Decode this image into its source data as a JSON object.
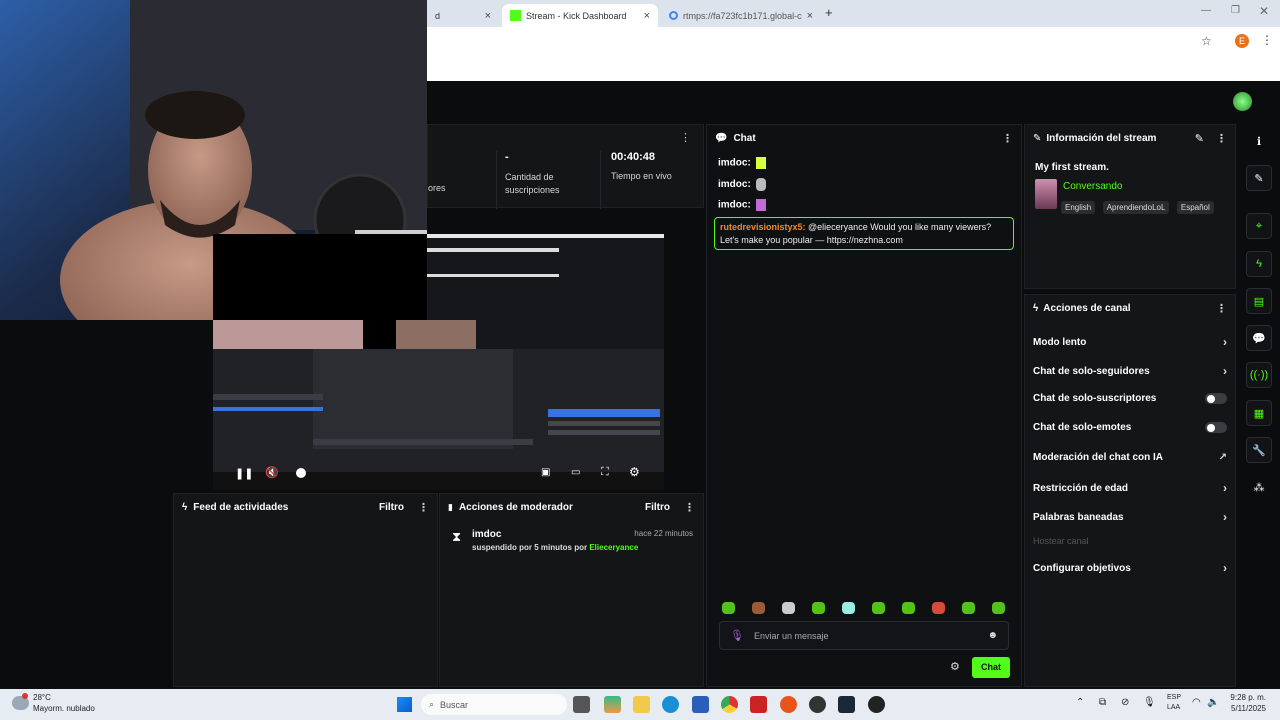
{
  "browser": {
    "tabs": [
      {
        "label": "d",
        "close": "×"
      },
      {
        "label": "Stream - Kick Dashboard",
        "close": "×"
      },
      {
        "label": "rtmps://fa723fc1b171.global-c",
        "close": "×"
      }
    ],
    "new_tab": "+",
    "profile_initial": "E"
  },
  "stats": {
    "partial_label": "ores",
    "subs_value": "-",
    "subs_label": "Cantidad de suscripciones",
    "time_value": "00:40:48",
    "time_label": "Tiempo en vivo"
  },
  "chat": {
    "title": "Chat",
    "messages": [
      {
        "user": "imdoc:",
        "text": ""
      },
      {
        "user": "imdoc:",
        "text": ""
      },
      {
        "user": "imdoc:",
        "text": ""
      }
    ],
    "highlight": {
      "user": "rutedrevisionistyx5:",
      "text": " @elieceryance Would you like many viewers? Let's make you popular — https://nezhna.com"
    },
    "input_placeholder": "Enviar un mensaje",
    "send_label": "Chat"
  },
  "stream_info": {
    "title": "Información del stream",
    "stream_title": "My first stream.",
    "category": "Conversando",
    "tags": [
      "English",
      "AprendiendoLoL",
      "Español"
    ]
  },
  "channel_actions": {
    "title": "Acciones de canal",
    "items": [
      {
        "label": "Modo lento",
        "control": "chevron"
      },
      {
        "label": "Chat de solo-seguidores",
        "control": "chevron"
      },
      {
        "label": "Chat de solo-suscriptores",
        "control": "toggle"
      },
      {
        "label": "Chat de solo-emotes",
        "control": "toggle"
      },
      {
        "label": "Moderación del chat con IA",
        "control": "external"
      },
      {
        "label": "Restricción de edad",
        "control": "chevron"
      },
      {
        "label": "Palabras baneadas",
        "control": "chevron"
      },
      {
        "label": "Hostear canal",
        "control": "disabled"
      },
      {
        "label": "Configurar objetivos",
        "control": "chevron"
      }
    ]
  },
  "activity_feed": {
    "title": "Feed de actividades",
    "filter": "Filtro"
  },
  "mod_actions": {
    "title": "Acciones de moderador",
    "filter": "Filtro",
    "entry": {
      "user": "imdoc",
      "time": "hace 22 minutos",
      "text": "suspendido por 5 minutos por ",
      "by": "Elieceryance"
    }
  },
  "taskbar": {
    "weather_temp": "28°C",
    "weather_desc": "Mayorm. nublado",
    "search": "Buscar",
    "lang": "ESP",
    "lang2": "LAA",
    "time": "9:28 p. m.",
    "date": "5/11/2025"
  },
  "colors": {
    "accent": "#53fc18",
    "panel": "#141517",
    "bg": "#0b0c0e"
  }
}
